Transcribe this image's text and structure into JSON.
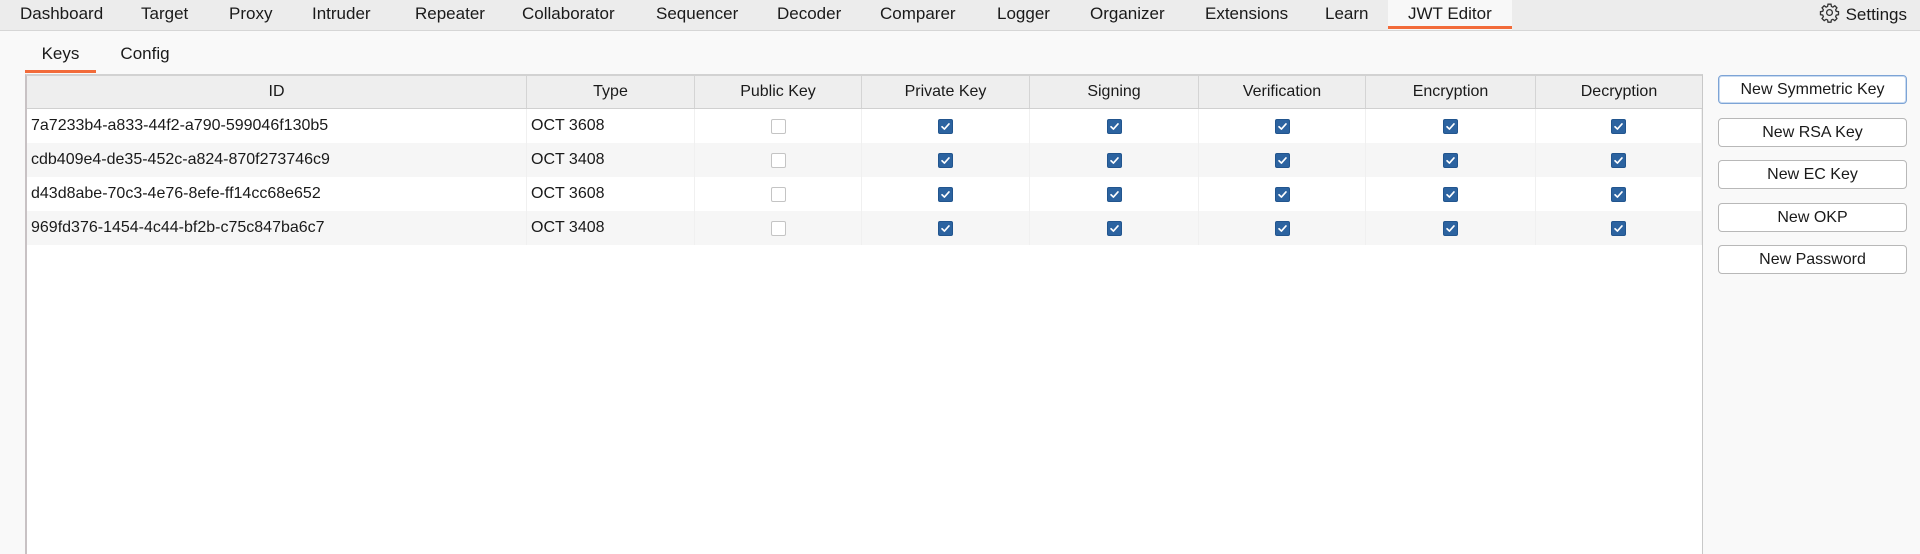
{
  "topnav": {
    "tabs": [
      {
        "label": "Dashboard",
        "active": false
      },
      {
        "label": "Target",
        "active": false
      },
      {
        "label": "Proxy",
        "active": false
      },
      {
        "label": "Intruder",
        "active": false
      },
      {
        "label": "Repeater",
        "active": false
      },
      {
        "label": "Collaborator",
        "active": false
      },
      {
        "label": "Sequencer",
        "active": false
      },
      {
        "label": "Decoder",
        "active": false
      },
      {
        "label": "Comparer",
        "active": false
      },
      {
        "label": "Logger",
        "active": false
      },
      {
        "label": "Organizer",
        "active": false
      },
      {
        "label": "Extensions",
        "active": false
      },
      {
        "label": "Learn",
        "active": false
      },
      {
        "label": "JWT Editor",
        "active": true
      }
    ],
    "settings_label": "Settings",
    "settings_icon": "gear-icon",
    "accent_color": "#f26b3a"
  },
  "subtabs": [
    {
      "label": "Keys",
      "active": true
    },
    {
      "label": "Config",
      "active": false
    }
  ],
  "keys_table": {
    "columns": [
      "ID",
      "Type",
      "Public Key",
      "Private Key",
      "Signing",
      "Verification",
      "Encryption",
      "Decryption"
    ],
    "rows": [
      {
        "id": "7a7233b4-a833-44f2-a790-599046f130b5",
        "type": "OCT 3608",
        "public_key": false,
        "private_key": true,
        "signing": true,
        "verification": true,
        "encryption": true,
        "decryption": true
      },
      {
        "id": "cdb409e4-de35-452c-a824-870f273746c9",
        "type": "OCT 3408",
        "public_key": false,
        "private_key": true,
        "signing": true,
        "verification": true,
        "encryption": true,
        "decryption": true
      },
      {
        "id": "d43d8abe-70c3-4e76-8efe-ff14cc68e652",
        "type": "OCT 3608",
        "public_key": false,
        "private_key": true,
        "signing": true,
        "verification": true,
        "encryption": true,
        "decryption": true
      },
      {
        "id": "969fd376-1454-4c44-bf2b-c75c847ba6c7",
        "type": "OCT 3408",
        "public_key": false,
        "private_key": true,
        "signing": true,
        "verification": true,
        "encryption": true,
        "decryption": true
      }
    ],
    "checkbox_color": "#2c63a0"
  },
  "actions": {
    "new_symmetric_key": "New Symmetric Key",
    "new_rsa_key": "New RSA Key",
    "new_ec_key": "New EC Key",
    "new_okp": "New OKP",
    "new_password": "New Password"
  }
}
